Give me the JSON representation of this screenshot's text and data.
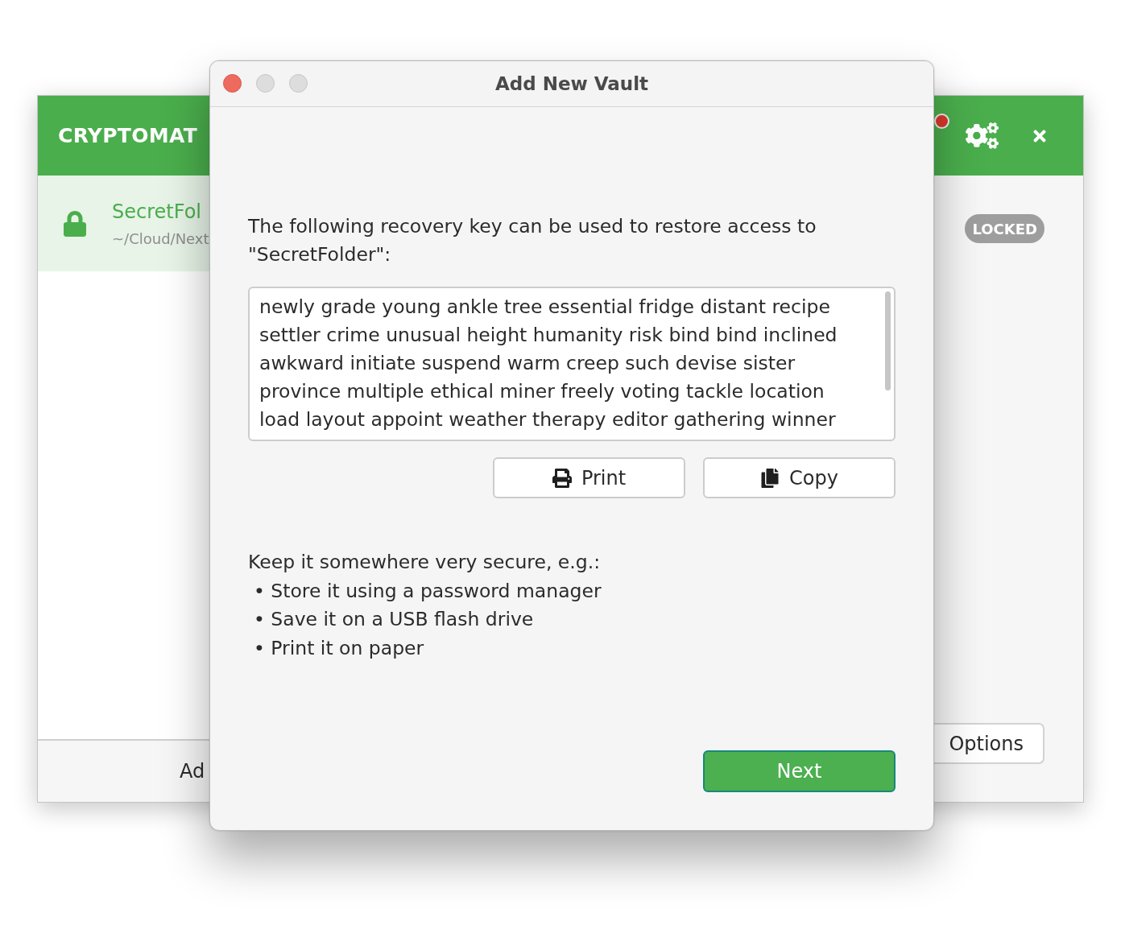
{
  "background_window": {
    "app_title": "CRYPTOMAT",
    "vaults": [
      {
        "name": "SecretFol",
        "path": "~/Cloud/Next",
        "selected": true,
        "locked": true
      }
    ],
    "add_button": "Ad",
    "detail": {
      "status_badge": "LOCKED",
      "options_button": "Options"
    }
  },
  "dialog": {
    "title": "Add New Vault",
    "window_controls": [
      {
        "kind": "close",
        "disabled": false
      },
      {
        "kind": "minimize",
        "disabled": true
      },
      {
        "kind": "zoom",
        "disabled": true
      }
    ],
    "intro": "The following recovery key can be used to restore access to \"SecretFolder\":",
    "recovery_key": "newly grade young ankle tree essential fridge distant recipe settler crime unusual height humanity risk bind bind inclined awkward initiate suspend warm creep such devise sister province multiple ethical miner freely voting tackle location load layout appoint weather therapy editor gathering winner",
    "actions": [
      {
        "kind": "print",
        "label": "Print"
      },
      {
        "kind": "copy",
        "label": "Copy"
      }
    ],
    "tips_heading": "Keep it somewhere very secure, e.g.:",
    "tips": [
      "• Store it using a password manager",
      "• Save it on a USB flash drive",
      "• Print it on paper"
    ],
    "next_button": "Next"
  }
}
